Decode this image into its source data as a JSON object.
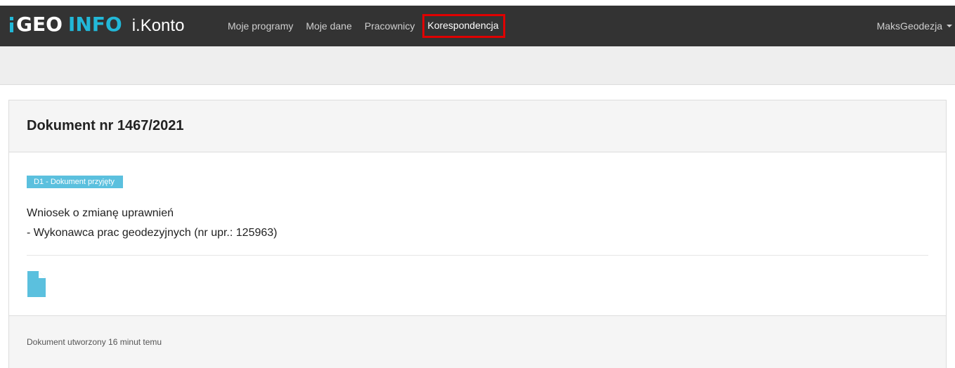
{
  "app": {
    "logo_geo": "GEO",
    "logo_info": "INFO",
    "logo_product": "i.Konto"
  },
  "nav": {
    "items": [
      {
        "label": "Moje programy"
      },
      {
        "label": "Moje dane"
      },
      {
        "label": "Pracownicy"
      },
      {
        "label": "Korespondencja",
        "active": true
      }
    ]
  },
  "user": {
    "name": "MaksGeodezja",
    "icon": "caret-down-icon"
  },
  "document": {
    "title": "Dokument nr 1467/2021",
    "status": "D1 - Dokument przyjęty",
    "description_line1": "Wniosek o zmianę uprawnień",
    "description_line2": "- Wykonawca prac geodezyjnych (nr upr.: 125963)",
    "attachment_icon": "file-icon",
    "footer": "Dokument utworzony 16 minut temu"
  },
  "colors": {
    "topbar": "#333333",
    "accent": "#22b8d8",
    "badge": "#5bc0de",
    "highlight": "#e00000",
    "file_icon": "#5bc0de"
  }
}
